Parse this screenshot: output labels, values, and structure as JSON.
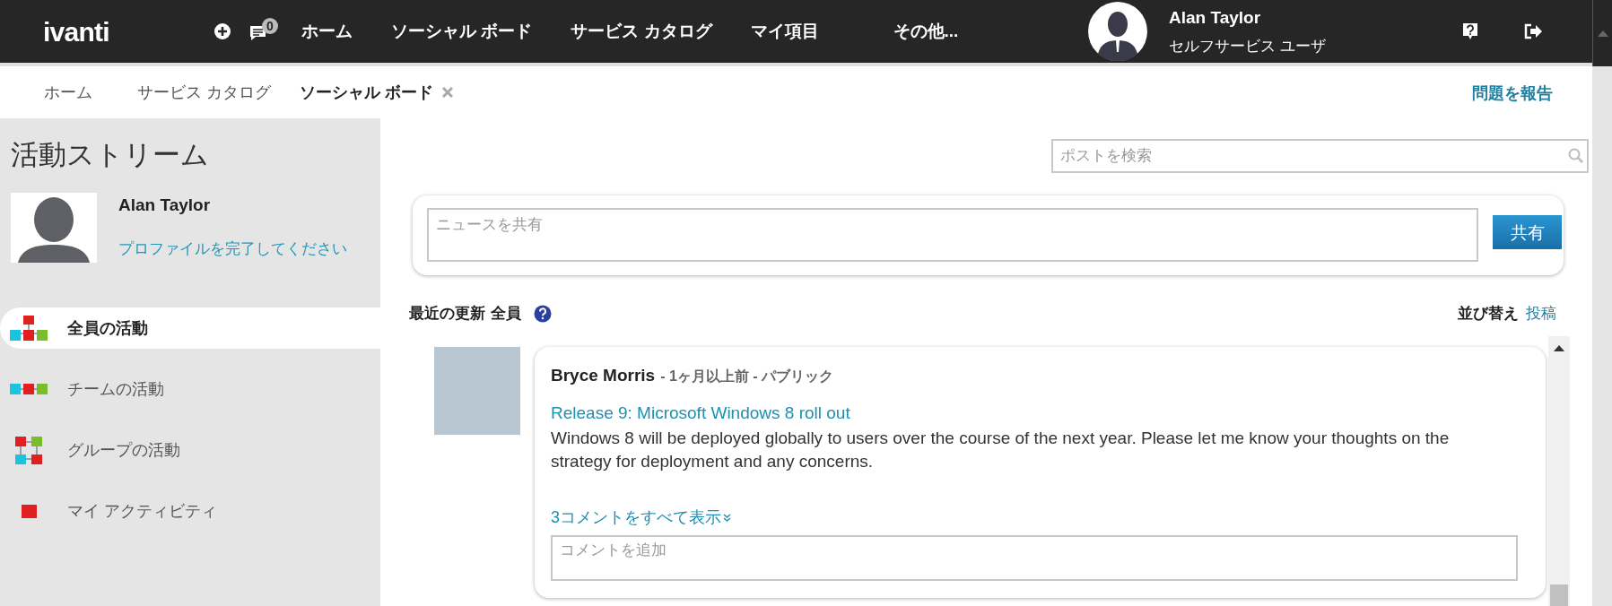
{
  "top_bar": {
    "logo": "ivanti",
    "message_count": "0",
    "nav": [
      "ホーム",
      "ソーシャル ボード",
      "サービス カタログ",
      "マイ項目",
      "その他..."
    ],
    "user": {
      "name": "Alan Taylor",
      "role": "セルフサービス ユーザ"
    }
  },
  "tabs": [
    {
      "label": "ホーム",
      "selected": false,
      "closable": false
    },
    {
      "label": "サービス カタログ",
      "selected": false,
      "closable": false
    },
    {
      "label": "ソーシャル ボード",
      "selected": true,
      "closable": true
    }
  ],
  "report_link": "問題を報告",
  "sidebar": {
    "title": "活動ストリーム",
    "profile": {
      "name": "Alan Taylor",
      "link": "プロファイルを完了してください"
    },
    "items": [
      {
        "label": "全員の活動",
        "kind": "all",
        "selected": true
      },
      {
        "label": "チームの活動",
        "kind": "team",
        "selected": false
      },
      {
        "label": "グループの活動",
        "kind": "group",
        "selected": false
      },
      {
        "label": "マイ アクティビティ",
        "kind": "mine",
        "selected": false
      }
    ]
  },
  "search": {
    "placeholder": "ポストを検索"
  },
  "share": {
    "placeholder": "ニュースを共有",
    "button": "共有"
  },
  "feed": {
    "heading": "最近の更新 全員",
    "sort_label": "並び替え",
    "sort_value": "投稿",
    "posts": [
      {
        "author": "Bryce Morris",
        "meta": "- 1ヶ月以上前 - パブリック",
        "title": "Release 9: Microsoft Windows 8 roll out",
        "body": "Windows 8 will be deployed globally to users over the course of the next year. Please let me know your thoughts on the strategy for deployment and any concerns.",
        "comments_link": "3コメントをすべて表示",
        "comment_placeholder": "コメントを追加"
      }
    ]
  }
}
